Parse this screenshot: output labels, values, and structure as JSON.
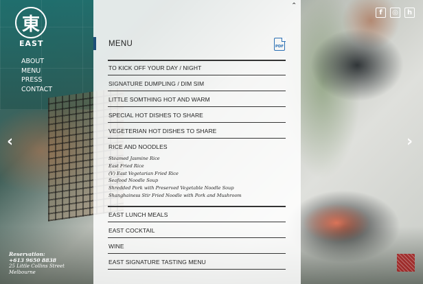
{
  "brand": {
    "glyph": "東",
    "name": "EAST"
  },
  "left_nav": [
    "ABOUT",
    "MENU",
    "PRESS",
    "CONTACT"
  ],
  "reservation": {
    "label": "Reservation:",
    "phone": "+613 9650 8838",
    "address1": "25 Little Collins Street",
    "address2": "Melbourne"
  },
  "social": [
    {
      "name": "facebook-icon",
      "glyph": "f"
    },
    {
      "name": "instagram-icon",
      "glyph": "◎"
    },
    {
      "name": "houzz-icon",
      "glyph": "h"
    }
  ],
  "carousel": {
    "prev": "‹",
    "next": "›",
    "up": "⌃"
  },
  "menu": {
    "title": "MENU",
    "pdf_label": "PDF",
    "categories": [
      "TO KICK OFF YOUR DAY / NIGHT",
      "SIGNATURE DUMPLING / DIM SIM",
      "LITTLE SOMTHING HOT AND WARM",
      "SPECIAL HOT DISHES TO SHARE",
      "VEGETERIAN HOT DISHES TO SHARE",
      "RICE AND NOODLES"
    ],
    "rice_items": [
      "Steamed Jasmine Rice",
      "East Fried Rice",
      "(V) East Vegetarian Fried Rice",
      "Seafood Noodle Soup",
      "Shredded Pork with Preserved Vegetable Noodle Soup",
      "Shanghainess Stir Fried Noodle with Pork and Mushroom"
    ],
    "lower_categories": [
      "EAST LUNCH MEALS",
      "EAST COCKTAIL",
      "WINE",
      "EAST SIGNATURE TASTING MENU"
    ]
  },
  "colors": {
    "accent": "#1d4e78",
    "pdf": "#2a6fb3",
    "stamp": "#a21c1c"
  }
}
